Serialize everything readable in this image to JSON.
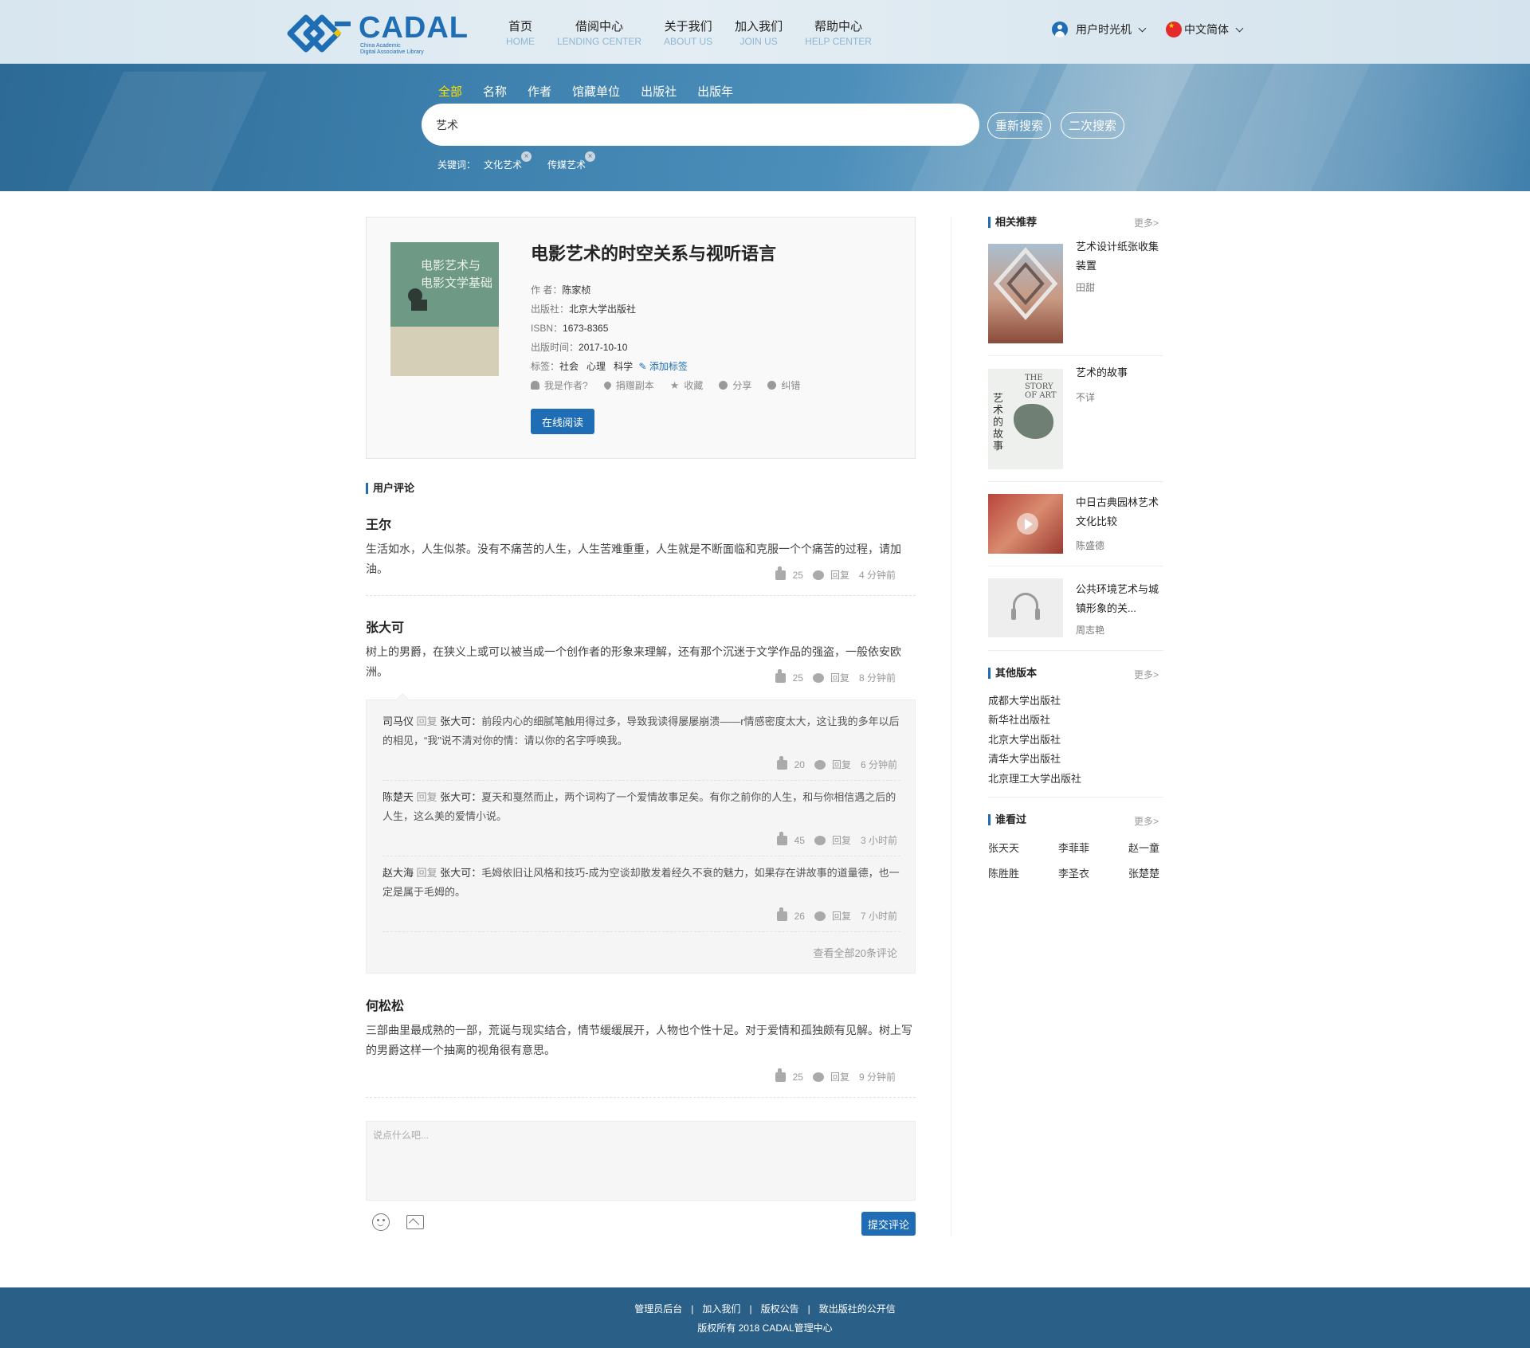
{
  "header": {
    "logo_text": "CADAL",
    "logo_sub1": "China Academic",
    "logo_sub2": "Digital Associative Library",
    "nav": [
      {
        "cn": "首页",
        "en": "HOME"
      },
      {
        "cn": "借阅中心",
        "en": "LENDING CENTER"
      },
      {
        "cn": "关于我们",
        "en": "ABOUT US"
      },
      {
        "cn": "加入我们",
        "en": "JOIN US"
      },
      {
        "cn": "帮助中心",
        "en": "HELP CENTER"
      }
    ],
    "user_name": "用户时光机",
    "language": "中文简体"
  },
  "search": {
    "tabs": [
      "全部",
      "名称",
      "作者",
      "馆藏单位",
      "出版社",
      "出版年"
    ],
    "active_tab": "全部",
    "query": "艺术",
    "research_label": "重新搜索",
    "secondary_label": "二次搜索",
    "keywords_label": "关键词：",
    "keywords": [
      "文化艺术",
      "传媒艺术"
    ],
    "close_glyph": "×"
  },
  "book": {
    "cover_text_1": "电影艺术与",
    "cover_text_2": "电影文学基础",
    "title": "电影艺术的时空关系与视听语言",
    "author_label": "作  者：",
    "author": "陈家桢",
    "publisher_label": "出版社：",
    "publisher": "北京大学出版社",
    "isbn_label": "ISBN：",
    "isbn": "1673-8365",
    "date_label": "出版时间：",
    "date": "2017-10-10",
    "tags_label": "标签：",
    "tags": [
      "社会",
      "心理",
      "科学"
    ],
    "add_tag": "添加标签",
    "actions": [
      "我是作者?",
      "捐赠副本",
      "收藏",
      "分享",
      "纠错"
    ],
    "read_button": "在线阅读"
  },
  "comments_title": "用户评论",
  "comments": [
    {
      "name": "王尔",
      "text": "生活如水，人生似茶。没有不痛苦的人生，人生苦难重重，人生就是不断面临和克服一个个痛苦的过程，请加油。",
      "likes": "25",
      "reply": "回复",
      "time": "4 分钟前"
    },
    {
      "name": "张大可",
      "text": "树上的男爵，在狭义上或可以被当成一个创作者的形象来理解，还有那个沉迷于文学作品的强盗，一般依安欧洲。",
      "likes": "25",
      "reply": "回复",
      "time": "8 分钟前"
    },
    {
      "name": "何松松",
      "text": "三部曲里最成熟的一部，荒诞与现实结合，情节缓缓展开，人物也个性十足。对于爱情和孤独颇有见解。树上写的男爵这样一个抽离的视角很有意思。",
      "likes": "25",
      "reply": "回复",
      "time": "9 分钟前"
    }
  ],
  "replies": [
    {
      "who": "司马仪",
      "reply_word": " 回复 ",
      "target": "张大可：",
      "text": "前段内心的细腻笔触用得过多，导致我读得屡屡崩溃——r情感密度太大，这让我的多年以后的相见，“我”说不清对你的情：请以你的名字呼唤我。",
      "likes": "20",
      "reply": "回复",
      "time": "6 分钟前"
    },
    {
      "who": "陈楚天",
      "reply_word": " 回复 ",
      "target": "张大可：",
      "text": "夏天和戛然而止，两个词构了一个爱情故事足矣。有你之前你的人生，和与你相信遇之后的人生，这么美的爱情小说。",
      "likes": "45",
      "reply": "回复",
      "time": "3 小时前"
    },
    {
      "who": "赵大海",
      "reply_word": " 回复 ",
      "target": "张大可：",
      "text": "毛姆依旧让风格和技巧-成为空谈却散发着经久不衰的魅力，如果存在讲故事的道量德，也一定是属于毛姆的。",
      "likes": "26",
      "reply": "回复",
      "time": "7 小时前"
    }
  ],
  "view_all": "查看全部20条评论",
  "comment_input": {
    "placeholder": "说点什么吧..."
  },
  "submit_label": "提交评论",
  "sidebar": {
    "related_title": "相关推荐",
    "more": "更多>",
    "related": [
      {
        "title": "艺术设计纸张收集装置",
        "author": "田甜"
      },
      {
        "title": "艺术的故事",
        "author": "不详",
        "cover_text": "THE STORY OF ART",
        "cover_cn": "艺术的故事"
      },
      {
        "title": "中日古典园林艺术文化比较",
        "author": "陈盛德"
      },
      {
        "title": "公共环境艺术与城镇形象的关...",
        "author": "周志艳"
      }
    ],
    "versions_title": "其他版本",
    "versions": [
      "成都大学出版社",
      "新华社出版社",
      "北京大学出版社",
      "清华大学出版社",
      "北京理工大学出版社"
    ],
    "viewers_title": "谁看过",
    "viewers": [
      "张天天",
      "李菲菲",
      "赵一童",
      "陈胜胜",
      "李圣衣",
      "张楚楚"
    ]
  },
  "footer": {
    "links": [
      "管理员后台",
      "加入我们",
      "版权公告",
      "致出版社的公开信"
    ],
    "divider": "|",
    "copyright": "版权所有 2018 CADAL管理中心"
  },
  "colors": {
    "accent": "#1e6db5",
    "footer": "#2a5f87",
    "active_tab": "#ffe000"
  }
}
